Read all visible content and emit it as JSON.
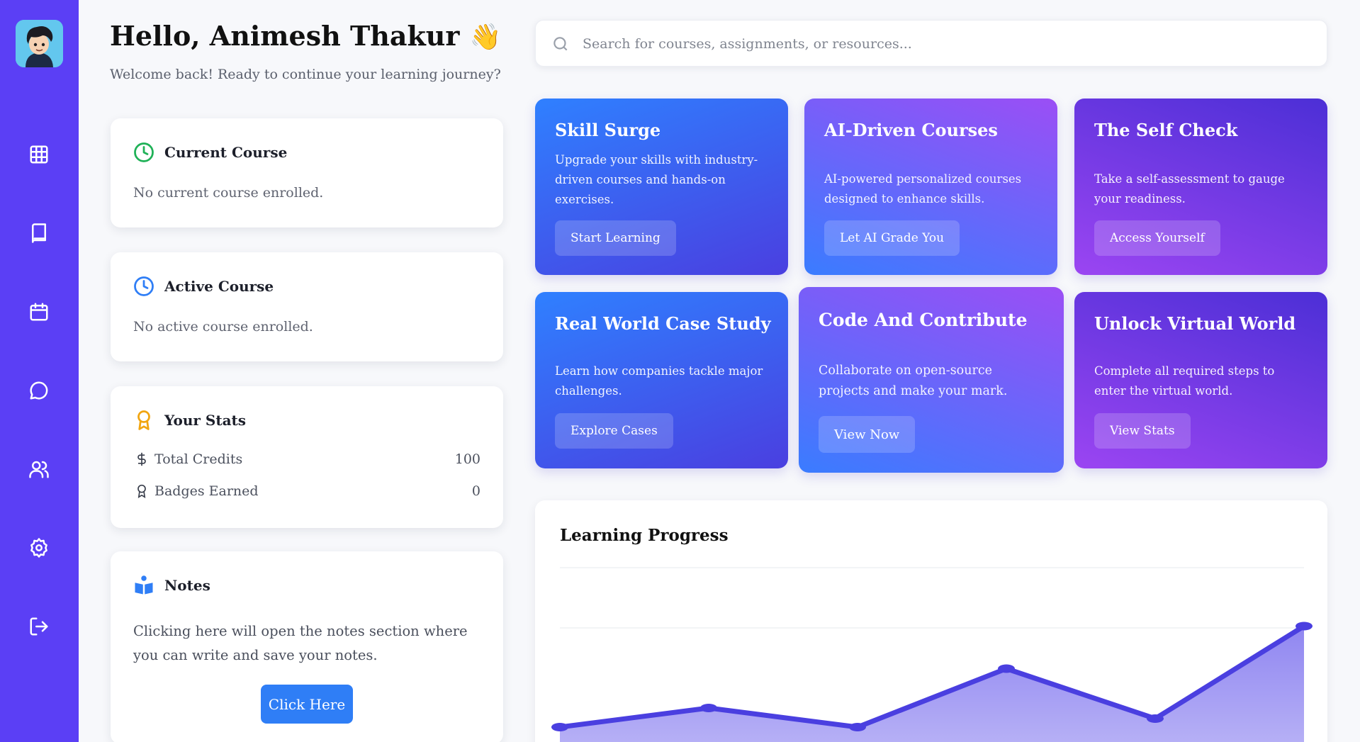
{
  "user": {
    "greeting": "Hello, Animesh Thakur",
    "wave": "👋",
    "subtitle": "Welcome back! Ready to continue your learning journey?"
  },
  "sidebar": {
    "items": [
      {
        "icon": "grid-icon"
      },
      {
        "icon": "book-icon"
      },
      {
        "icon": "calendar-icon"
      },
      {
        "icon": "chat-icon"
      },
      {
        "icon": "users-icon"
      },
      {
        "icon": "settings-icon"
      },
      {
        "icon": "logout-icon"
      }
    ],
    "color": "#5b3ff5"
  },
  "search": {
    "placeholder": "Search for courses, assignments, or resources..."
  },
  "current_course": {
    "title": "Current Course",
    "text": "No current course enrolled."
  },
  "active_course": {
    "title": "Active Course",
    "text": "No active course enrolled."
  },
  "stats": {
    "title": "Your Stats",
    "credits_label": "Total Credits",
    "credits_value": "100",
    "badges_label": "Badges Earned",
    "badges_value": "0"
  },
  "notes": {
    "title": "Notes",
    "text": "Clicking here will open the notes section where you can write and save your notes.",
    "button": "Click Here"
  },
  "tiles": [
    {
      "title": "Skill Surge",
      "desc": "Upgrade your skills with industry-driven courses and hands-on exercises.",
      "button": "Start Learning"
    },
    {
      "title": "AI-Driven Courses",
      "desc": "AI-powered personalized courses designed to enhance skills.",
      "button": "Let AI Grade You"
    },
    {
      "title": "The Self Check",
      "desc": "Take a self-assessment to gauge your readiness.",
      "button": "Access Yourself"
    },
    {
      "title": "Real World Case Study",
      "desc": "Learn how companies tackle major challenges.",
      "button": "Explore Cases"
    },
    {
      "title": "Code And Contribute",
      "desc": "Collaborate on open-source projects and make your mark.",
      "button": "View Now"
    },
    {
      "title": "Unlock Virtual World",
      "desc": "Complete all required steps to enter the virtual world.",
      "button": "View Stats"
    }
  ],
  "progress": {
    "title": "Learning Progress",
    "colors": {
      "line": "#4a3fe0",
      "fill": "#8a80f0"
    }
  },
  "chart_data": {
    "type": "area",
    "title": "Learning Progress",
    "x": [
      0,
      1,
      2,
      3,
      4,
      5
    ],
    "values": [
      0,
      18,
      0,
      55,
      8,
      95
    ],
    "ylim": [
      0,
      150
    ],
    "grid": true
  }
}
